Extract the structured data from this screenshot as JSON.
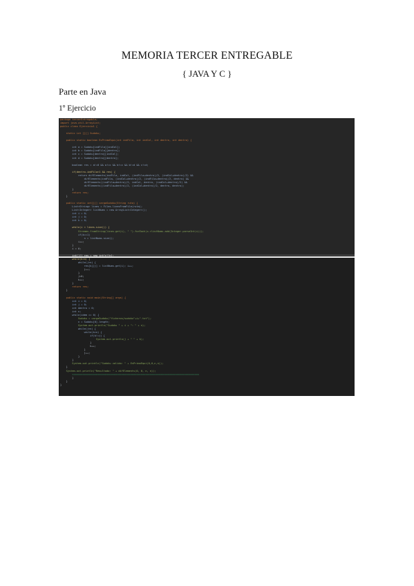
{
  "document": {
    "title": "MEMORIA TERCER ENTREGABLE",
    "subtitle": "{ JAVA Y C }",
    "section_heading": "Parte en Java",
    "exercise_heading": "1º Ejercicio"
  },
  "code_screenshot_top": {
    "language": "java",
    "lines": [
      [
        "kw",
        "package tercerEntregable;"
      ],
      [
        "kw",
        "import java.util.ArrayList;"
      ],
      [
        "kw",
        "public class Ejercicio1 {"
      ],
      [
        "pl",
        ""
      ],
      [
        "kw",
        "    static int [][] Sudoku;"
      ],
      [
        "pl",
        ""
      ],
      [
        "kw",
        "    public static boolean EsPrimoEqui(int indFila, int indCol, int dentro, int dentro) {"
      ],
      [
        "pl",
        ""
      ],
      [
        "id",
        "        int a = Sudoku[indFila][indCol];"
      ],
      [
        "id",
        "        int b = Sudoku[indFila][dentro];"
      ],
      [
        "id",
        "        int c = Sudoku[dentro][indCol];"
      ],
      [
        "id",
        "        int d = Sudoku[dentro][dentro];"
      ],
      [
        "pl",
        ""
      ],
      [
        "id",
        "        boolean res = a!=0 && a!=c && b!=c && b!=d && c!=d;"
      ],
      [
        "pl",
        ""
      ],
      [
        "fn",
        "        if(dentro-indFila>1 && res) {"
      ],
      [
        "id",
        "            return difElements(indFila, indCol, (indFila+dentro)/2, (indCol+dentro)/2) &&"
      ],
      [
        "id",
        "                difElements(indFila, (indCol+dentro)/2, (indFila+dentro)/2, dentro) &&"
      ],
      [
        "id",
        "                difElements((indFila+dentro)/2, indCol, dentro, (indCol+dentro)/2) &&"
      ],
      [
        "id",
        "                difElements((indFila+dentro)/2, (indCol+dentro)/2, dentro, dentro);"
      ],
      [
        "pl",
        "        }"
      ],
      [
        "kw",
        "        return res;"
      ],
      [
        "pl",
        "    }"
      ],
      [
        "pl",
        ""
      ],
      [
        "kw",
        "    public static int[][] cargaSudoku(String ruta) {"
      ],
      [
        "id",
        "        List<String> lines = Files.linesFromFile(ruta);"
      ],
      [
        "id",
        "        List<Integer> listNums = new ArrayList<Integer>();"
      ],
      [
        "num",
        "        int i = 0;"
      ],
      [
        "num",
        "        int j = 0;"
      ],
      [
        "num",
        "        int k = 0;"
      ],
      [
        "pl",
        ""
      ],
      [
        "fn",
        "        while(i < lines.size()) {"
      ],
      [
        "str",
        "            Streams.fromString(lines.get(i), \" \").forEach(x->listNums.add(Integer.parseInt(x)));"
      ],
      [
        "id",
        "            if(k==1)"
      ],
      [
        "id",
        "                n = listNums.size();"
      ],
      [
        "pl",
        "            i++;"
      ],
      [
        "pl",
        "        }"
      ],
      [
        "pl",
        "        i = 0;"
      ],
      [
        "pl",
        ""
      ],
      [
        "hl",
        "        int[][] res = new int[n][n];"
      ]
    ]
  },
  "code_screenshot_bottom": {
    "language": "java",
    "lines": [
      [
        "fn",
        "        while(k<n) {"
      ],
      [
        "id",
        "            while(j<n) {"
      ],
      [
        "id",
        "                res[k][j] = listNums.get(i); i++;"
      ],
      [
        "pl",
        "                j++;"
      ],
      [
        "pl",
        "            }"
      ],
      [
        "pl",
        "            j=0;"
      ],
      [
        "pl",
        "            k++;"
      ],
      [
        "pl",
        "        }"
      ],
      [
        "kw",
        "        return res;"
      ],
      [
        "pl",
        "    }"
      ],
      [
        "pl",
        ""
      ],
      [
        "kw",
        "    public static void main(String[] args) {"
      ],
      [
        "num",
        "        int i = 0;"
      ],
      [
        "num",
        "        int j = 0;"
      ],
      [
        "id",
        "        int dentro = 0;"
      ],
      [
        "id",
        "        int n;"
      ],
      [
        "id",
        "        while(idem == 0) {"
      ],
      [
        "str",
        "            Sudoku = cargaSudoku(\"ficheros/sudoku\"+i+\".txt\");"
      ],
      [
        "id",
        "            n = Sudoku[0].length;"
      ],
      [
        "str",
        "            System.out.println(\"Sudoku \" + i + \": \" + n);"
      ],
      [
        "id",
        "            while(j<n) {"
      ],
      [
        "id",
        "                while(k<n) {"
      ],
      [
        "id",
        "                    if(k!=j) {"
      ],
      [
        "str",
        "                        System.out.println(j + \" \" + k);"
      ],
      [
        "pl",
        "                    }"
      ],
      [
        "pl",
        "                    k++;"
      ],
      [
        "pl",
        "                }"
      ],
      [
        "pl",
        "                j++;"
      ],
      [
        "pl",
        "            }"
      ],
      [
        "pl",
        "        }"
      ],
      [
        "str",
        "        System.out.println(\"Sudoku valido: \" + EsPrimoEqui(0,0,n,n));"
      ],
      [
        "pl",
        "    }"
      ],
      [
        "str",
        "    System.out.println(\"Resultado: \" + difElements(0, 0, n, n));"
      ],
      [
        "green",
        "        ====================================================================================="
      ],
      [
        "pl",
        "        }"
      ],
      [
        "pl",
        "    }"
      ],
      [
        "pl",
        "}"
      ]
    ]
  }
}
